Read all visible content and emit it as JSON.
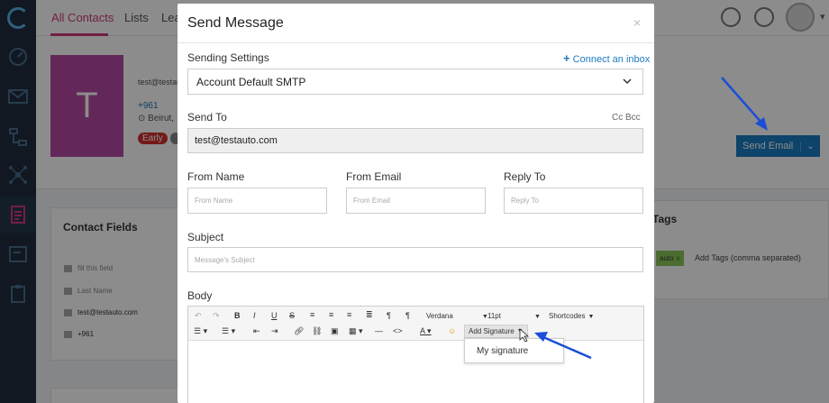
{
  "background": {
    "tabs": [
      "All Contacts",
      "Lists",
      "Lea"
    ],
    "contact": {
      "initial": "T",
      "email": "test@testauto",
      "phone": "+961",
      "city": "Beirut,",
      "badge": "Early"
    },
    "send_email_label": "Send Email",
    "contact_fields": {
      "title": "Contact Fields",
      "rows": [
        "fill this field",
        "Last Name",
        "test@testauto.com",
        "+961"
      ]
    },
    "tags": {
      "title": "Tags",
      "chip": "auto",
      "chip_remove": "x",
      "placeholder": "Add Tags (comma separated)"
    }
  },
  "modal": {
    "title": "Send Message",
    "close": "×",
    "sending_settings_label": "Sending Settings",
    "connect_inbox": "Connect an inbox",
    "smtp_value": "Account Default SMTP",
    "send_to_label": "Send To",
    "cc_bcc": "Cc Bcc",
    "send_to_value": "test@testauto.com",
    "from_name_label": "From Name",
    "from_name_placeholder": "From Name",
    "from_email_label": "From Email",
    "from_email_placeholder": "From Email",
    "reply_to_label": "Reply To",
    "reply_to_placeholder": "Reply To",
    "subject_label": "Subject",
    "subject_placeholder": "Message's Subject",
    "body_label": "Body",
    "toolbar": {
      "font": "Verdana",
      "size": "11pt",
      "shortcodes": "Shortcodes",
      "add_signature": "Add Signature"
    },
    "signature_menu": [
      "My signature"
    ]
  },
  "colors": {
    "sidebar": "#1f2d3d",
    "accent_pink": "#d23a7c",
    "primary_blue": "#1b7bc2",
    "annotation_arrow": "#1a4fd6"
  }
}
